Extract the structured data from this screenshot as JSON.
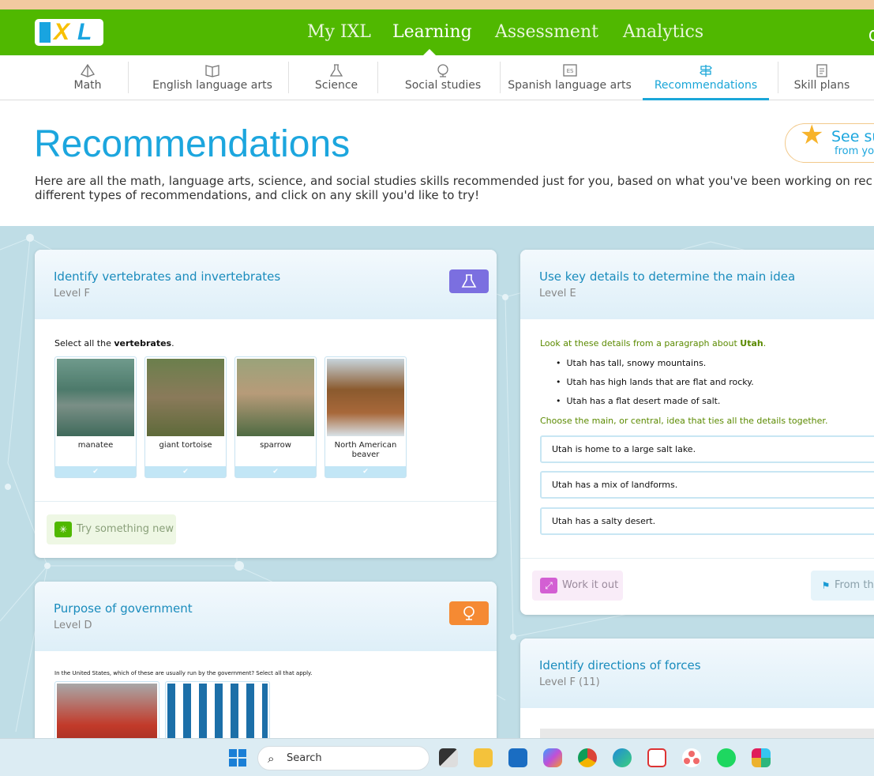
{
  "nav": {
    "logo_text": "IXL",
    "links": [
      "My IXL",
      "Learning",
      "Assessment",
      "Analytics"
    ],
    "active": "Learning"
  },
  "subnav": {
    "tabs": [
      {
        "label": "Math",
        "icon": "pyramid-icon"
      },
      {
        "label": "English language arts",
        "icon": "book-icon"
      },
      {
        "label": "Science",
        "icon": "flask-icon"
      },
      {
        "label": "Social studies",
        "icon": "globe-icon"
      },
      {
        "label": "Spanish language arts",
        "icon": "es-book-icon"
      },
      {
        "label": "Recommendations",
        "icon": "signpost-icon"
      },
      {
        "label": "Skill plans",
        "icon": "clipboard-icon"
      }
    ],
    "active": "Recommendations"
  },
  "page": {
    "title": "Recommendations",
    "intro_line1": "Here are all the math, language arts, science, and social studies skills recommended just for you, based on what you've been working on rec",
    "intro_line2": "different types of recommendations, and click on any skill you'd like to try!",
    "see_button_line1": "See su",
    "see_button_line2": "from yo"
  },
  "cards": {
    "vertebrates": {
      "title": "Identify vertebrates and invertebrates",
      "level": "Level F",
      "subject_icon": "flask-icon",
      "badge_color": "#7b6fe0",
      "prompt_prefix": "Select all the ",
      "prompt_bold": "vertebrates",
      "prompt_suffix": ".",
      "choices": [
        "manatee",
        "giant tortoise",
        "sparrow",
        "North American beaver"
      ],
      "action_label": "Try something new",
      "action_icon": "sparkle-icon"
    },
    "main_idea": {
      "title": "Use key details to determine the main idea",
      "level": "Level E",
      "intro_prefix": "Look at these details from a paragraph about ",
      "intro_bold": "Utah",
      "intro_suffix": ".",
      "bullets": [
        "Utah has tall, snowy mountains.",
        "Utah has high lands that are flat and rocky.",
        "Utah has a flat desert made of salt."
      ],
      "question": "Choose the main, or central, idea that ties all the details together.",
      "answers": [
        "Utah is home to a large salt lake.",
        "Utah has a mix of landforms.",
        "Utah has a salty desert."
      ],
      "action_label": "Work it out",
      "action_icon": "arrows-icon",
      "action2_label": "From the"
    },
    "government": {
      "title": "Purpose of government",
      "level": "Level D",
      "subject_icon": "globe-icon",
      "badge_color": "#f58a33",
      "prompt": "In the United States, which of these are usually run by the government? Select all that apply."
    },
    "forces": {
      "title": "Identify directions of forces",
      "level": "Level F (11)"
    }
  },
  "taskbar": {
    "search_placeholder": "Search",
    "apps": [
      "windows-start-icon",
      "task-view-icon",
      "file-explorer-icon",
      "outlook-icon",
      "copilot-icon",
      "chrome-icon",
      "edge-icon",
      "snipping-tool-icon",
      "asana-icon",
      "spotify-icon",
      "slack-icon"
    ]
  }
}
